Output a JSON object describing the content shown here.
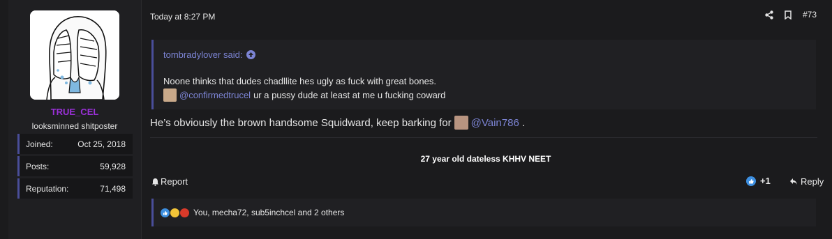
{
  "user": {
    "name": "TRUE_CEL",
    "title": "looksminned shitposter",
    "stats": [
      {
        "label": "Joined:",
        "value": "Oct 25, 2018"
      },
      {
        "label": "Posts:",
        "value": "59,928"
      },
      {
        "label": "Reputation:",
        "value": "71,498"
      }
    ]
  },
  "post": {
    "date": "Today at 8:27 PM",
    "number": "#73",
    "quote": {
      "author": "tombradylover said:",
      "line1": "Noone thinks that dudes chadllite hes ugly as fuck with great bones.",
      "mention": "@confirmedtrucel",
      "line2_rest": " ur a pussy dude at least at me u fucking coward"
    },
    "body_text": "He’s obviously the brown handsome Squidward, keep barking for",
    "body_mention": "@Vain786",
    "body_end": ".",
    "signature": "27 year old dateless KHHV NEET",
    "report_label": "Report",
    "reaction_count": "+1",
    "reply_label": "Reply",
    "reactions_text": "You, mecha72, sub5inchcel and 2 others"
  },
  "colors": {
    "accent": "#4a4e9a",
    "link": "#7c84d4",
    "username": "#9b30d9"
  },
  "icons": [
    "share-icon",
    "bookmark-icon",
    "bell-icon",
    "like-icon",
    "reply-icon",
    "arrow-up-icon"
  ]
}
